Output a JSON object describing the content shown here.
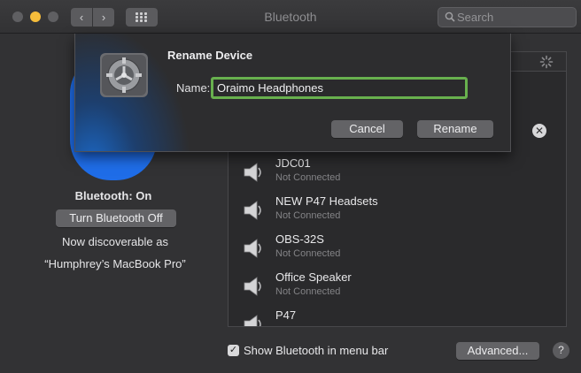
{
  "window": {
    "title": "Bluetooth"
  },
  "search": {
    "placeholder": "Search"
  },
  "left": {
    "status": "Bluetooth: On",
    "toggle_label": "Turn Bluetooth Off",
    "discoverable_line1": "Now discoverable as",
    "discoverable_line2": "“Humphrey’s MacBook Pro”"
  },
  "devices": [
    {
      "name": "JDC01",
      "status": "Not Connected"
    },
    {
      "name": "NEW P47 Headsets",
      "status": "Not Connected"
    },
    {
      "name": "OBS-32S",
      "status": "Not Connected"
    },
    {
      "name": "Office Speaker",
      "status": "Not Connected"
    },
    {
      "name": "P47",
      "status": ""
    }
  ],
  "footer": {
    "show_in_menu_bar": "Show Bluetooth in menu bar",
    "advanced_label": "Advanced...",
    "help_label": "?"
  },
  "sheet": {
    "title": "Rename Device",
    "name_label": "Name:",
    "name_value": "Oraimo Headphones",
    "cancel_label": "Cancel",
    "rename_label": "Rename"
  },
  "colors": {
    "accent_blue": "#1f6de8",
    "focus_green": "#68b04e"
  },
  "icons": [
    "search-icon",
    "gear-icon",
    "speaker-icon",
    "spinner-icon",
    "remove-icon",
    "checkmark-icon"
  ]
}
